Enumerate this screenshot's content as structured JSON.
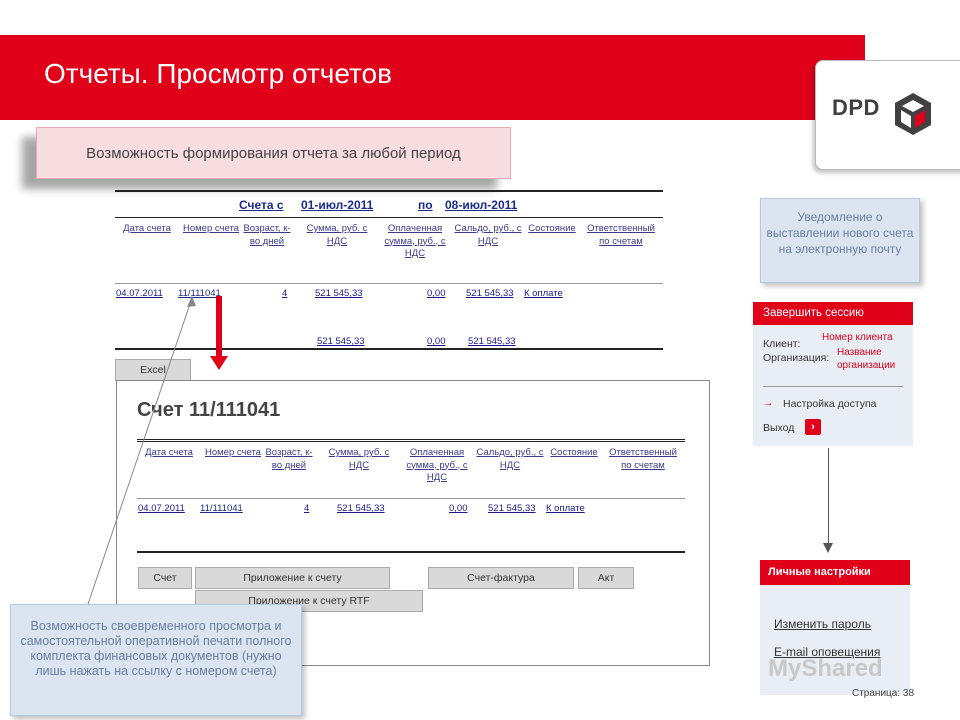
{
  "slide": {
    "title": "Отчеты. Просмотр отчетов",
    "page": "Страница: 38"
  },
  "logo": {
    "text": "DPD"
  },
  "callout_top": "Возможность формирования отчета за любой период",
  "report": {
    "title_prefix": "Счета с",
    "date_from": "01-июл-2011",
    "title_mid": "по",
    "date_to": "08-июл-2011",
    "columns": [
      "Дата счета",
      "Номер счета",
      "Возраст, к-во дней",
      "Сумма, руб. с НДС",
      "Оплаченная сумма, руб., с НДС",
      "Сальдо, руб., с НДС",
      "Состояние",
      "Ответственный по счетам"
    ],
    "row": [
      "04.07.2011",
      "11/111041",
      "4",
      "521 545,33",
      "0,00",
      "521 545,33",
      "К оплате"
    ],
    "totals": [
      "521 545,33",
      "0,00",
      "521 545,33"
    ],
    "excel_button": "Excel"
  },
  "invoice": {
    "title": "Счет 11/111041",
    "columns": [
      "Дата счета",
      "Номер счета",
      "Возраст, к-во дней",
      "Сумма, руб. с НДС",
      "Оплаченная сумма, руб., с НДС",
      "Сальдо, руб., с НДС",
      "Состояние",
      "Ответственный по счетам"
    ],
    "row": [
      "04.07.2011",
      "11/111041",
      "4",
      "521 545,33",
      "0,00",
      "521 545,33",
      "К оплате"
    ],
    "buttons": {
      "invoice": "Счет",
      "appendix": "Приложение к счету",
      "factura": "Счет-фактура",
      "act": "Акт",
      "appendix_rtf": "Приложение к счету RTF"
    }
  },
  "callout_bottom_left": "Возможность своевременного просмотра и самостоятельной оперативной печати полного комплекта финансовых документов (нужно лишь нажать на ссылку с номером счета)",
  "callout_right": "Уведомление о выставлении нового счета на электронную почту",
  "session": {
    "header": "Завершить сессию",
    "client_label": "Клиент:",
    "client_value": "Номер клиента",
    "org_label": "Организация:",
    "org_value": "Название организации",
    "access_link": "Настройка доступа",
    "exit_label": "Выход"
  },
  "personal": {
    "header": "Личные настройки",
    "change_password": "Изменить пароль",
    "email_notifications": "E-mail оповещения"
  },
  "watermark": "MyShared",
  "colors": {
    "accent": "#e1001a",
    "link": "#1a1a8c",
    "callout_blue": "#dbe5f1",
    "callout_pink": "#f7dce0"
  }
}
